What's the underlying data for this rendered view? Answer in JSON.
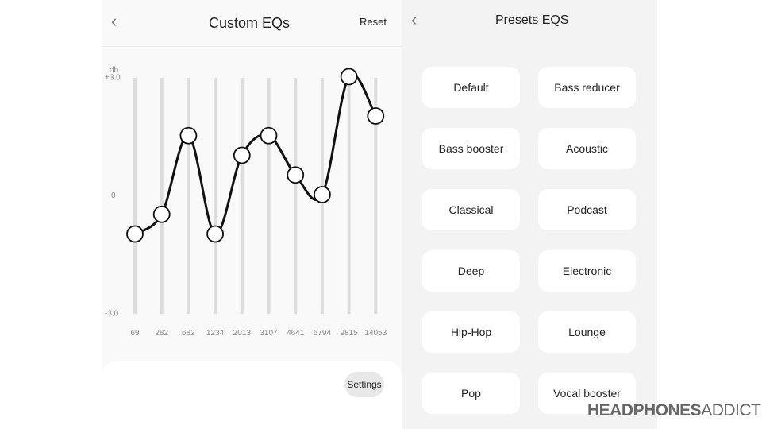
{
  "left": {
    "back_icon": "chevron-left",
    "title": "Custom EQs",
    "reset_label": "Reset",
    "settings_label": "Settings"
  },
  "chart_data": {
    "type": "line",
    "ylabel": "db",
    "yticks": [
      "+3.0",
      "0",
      "-3.0"
    ],
    "ylim": [
      -3,
      3
    ],
    "categories": [
      "69",
      "282",
      "682",
      "1234",
      "2013",
      "3107",
      "4641",
      "6794",
      "9815",
      "14053"
    ],
    "values": [
      -1.0,
      -0.5,
      1.5,
      -1.0,
      1.0,
      1.5,
      0.5,
      0.0,
      3.0,
      2.0
    ],
    "grid": false
  },
  "right": {
    "back_icon": "chevron-left",
    "title": "Presets EQS",
    "presets": [
      "Default",
      "Bass reducer",
      "Bass booster",
      "Acoustic",
      "Classical",
      "Podcast",
      "Deep",
      "Electronic",
      "Hip-Hop",
      "Lounge",
      "Pop",
      "Vocal booster"
    ]
  },
  "watermark": {
    "bold": "HEADPHONES",
    "light": "ADDICT"
  }
}
